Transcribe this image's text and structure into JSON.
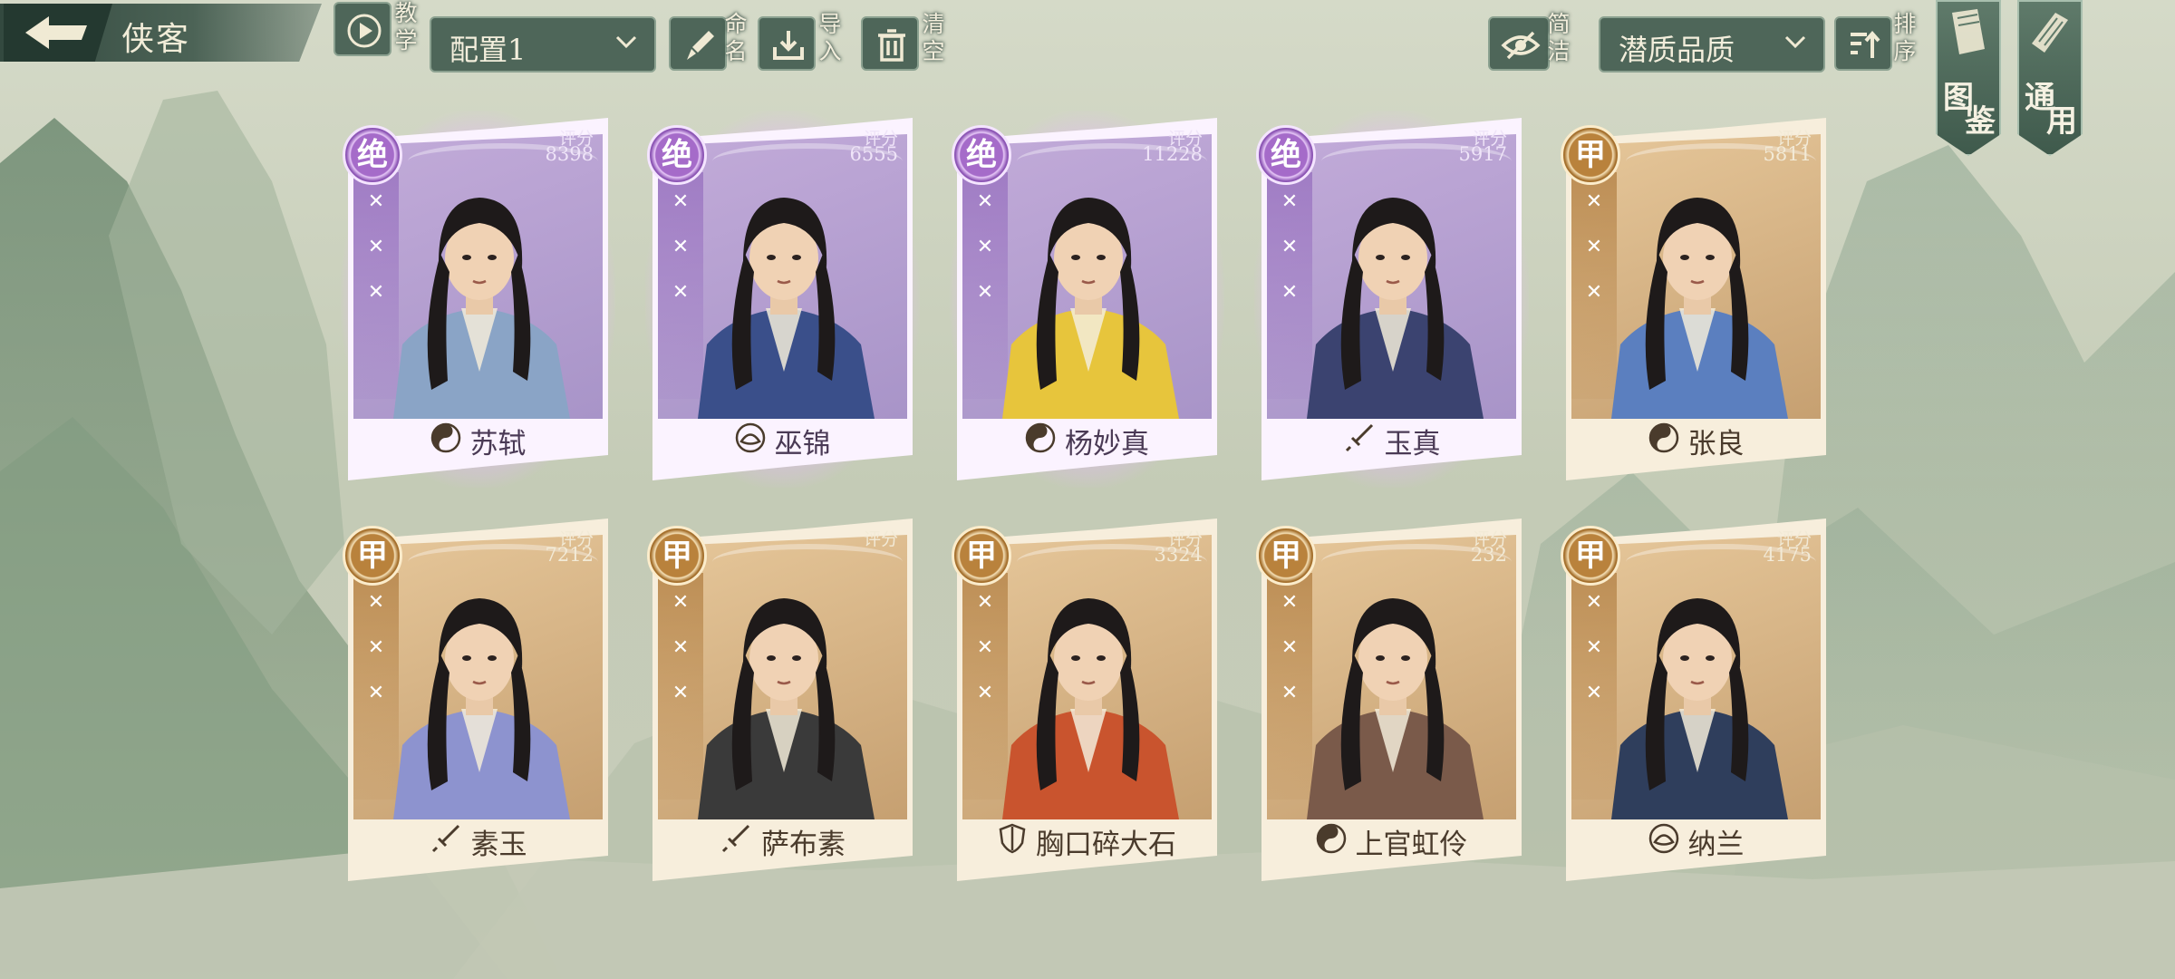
{
  "header": {
    "title": "侠客",
    "tutorial_label": "教学",
    "config_select": "配置1",
    "rename_label": "命名",
    "import_label": "导入",
    "clear_label": "清空",
    "concise_label": "简洁",
    "sort_select": "潜质品质",
    "sort_label": "排序",
    "atlas_tab": {
      "c1": "图",
      "c2": "鉴"
    },
    "general_tab": {
      "c1": "通",
      "c2": "用"
    }
  },
  "score_label": "评分",
  "colors": {
    "jue": "#a56bc9",
    "jia": "#b9823c",
    "panel": "#4e6659"
  },
  "heroes": [
    {
      "name": "苏轼",
      "grade": "绝",
      "score": "8398",
      "faction_icon": "yin-yang-icon",
      "robe": "#8aa4c6"
    },
    {
      "name": "巫锦",
      "grade": "绝",
      "score": "6555",
      "faction_icon": "lotus-icon",
      "robe": "#3a4f8a"
    },
    {
      "name": "杨妙真",
      "grade": "绝",
      "score": "11228",
      "faction_icon": "yin-yang-icon",
      "robe": "#e7c53c"
    },
    {
      "name": "玉真",
      "grade": "绝",
      "score": "5917",
      "faction_icon": "sword-icon",
      "robe": "#3b4370"
    },
    {
      "name": "张良",
      "grade": "甲",
      "score": "5811",
      "faction_icon": "yin-yang-icon",
      "robe": "#5b7fbf"
    },
    {
      "name": "素玉",
      "grade": "甲",
      "score": "7212",
      "faction_icon": "sword-icon",
      "robe": "#8d93cf"
    },
    {
      "name": "萨布素",
      "grade": "甲",
      "score": "",
      "faction_icon": "sword-icon",
      "robe": "#3a3a3a"
    },
    {
      "name": "胸口碎大石",
      "grade": "甲",
      "score": "3324",
      "faction_icon": "shield-icon",
      "robe": "#c9542e"
    },
    {
      "name": "上官虹伶",
      "grade": "甲",
      "score": "232",
      "faction_icon": "yin-yang-icon",
      "robe": "#7a5a4a"
    },
    {
      "name": "纳兰",
      "grade": "甲",
      "score": "4175",
      "faction_icon": "lotus-icon",
      "robe": "#2f3e5c"
    }
  ]
}
